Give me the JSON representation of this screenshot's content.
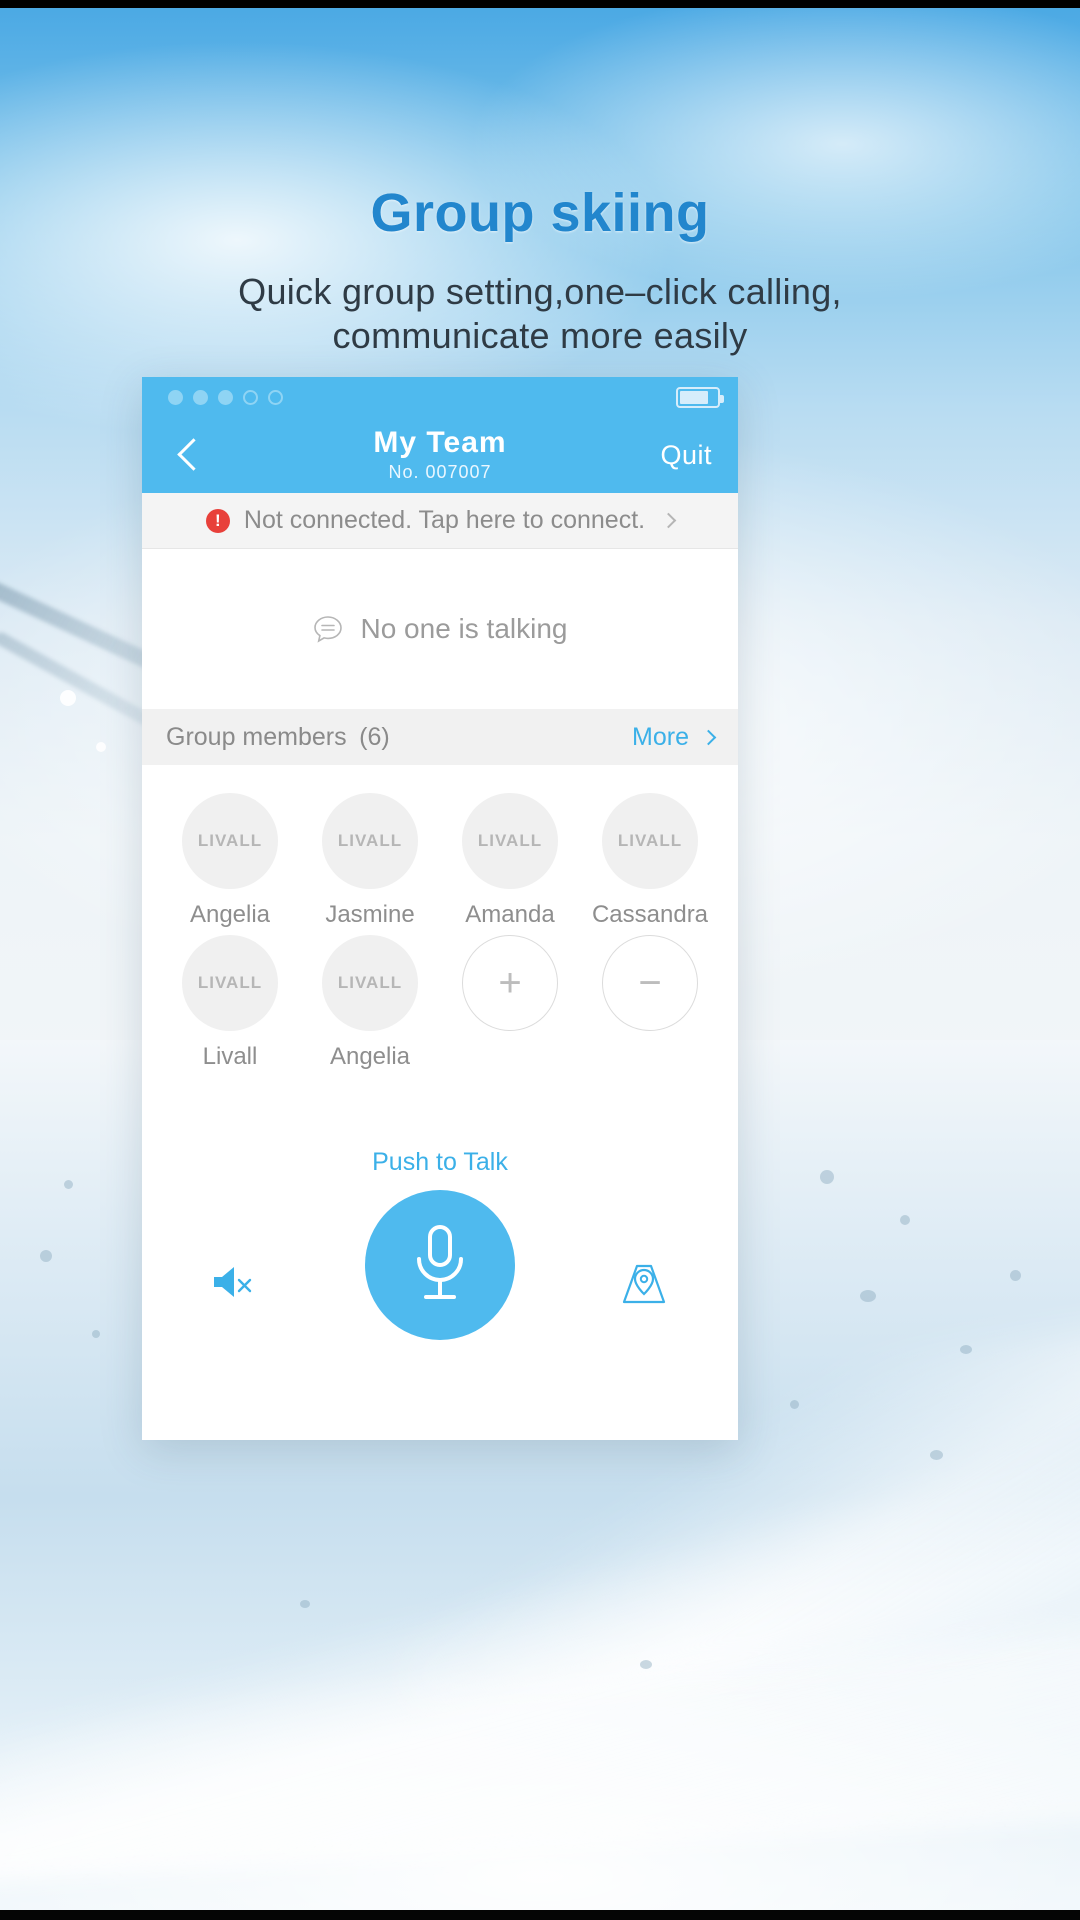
{
  "promo": {
    "headline": "Group skiing",
    "subhead_line1": "Quick group setting,one–click calling,",
    "subhead_line2": "communicate more easily",
    "headline_color": "#2286cd"
  },
  "phone": {
    "status_bar": {
      "signal_dots": [
        "filled",
        "filled",
        "filled",
        "hollow",
        "hollow"
      ],
      "battery_icon": "battery-icon",
      "battery_level_percent": 70,
      "accent_color": "#4fbaee"
    },
    "nav": {
      "back_icon": "chevron-left-icon",
      "title": "My Team",
      "subtitle": "No. 007007",
      "quit_label": "Quit"
    },
    "connect_banner": {
      "alert_icon": "alert-circle-icon",
      "alert_color": "#e8403a",
      "text": "Not connected. Tap here to connect.",
      "chevron_icon": "chevron-right-icon"
    },
    "talk_status": {
      "icon": "speech-bubble-icon",
      "text": "No one is talking"
    },
    "members_header": {
      "label": "Group members (6)",
      "more_label": "More",
      "more_chevron_icon": "chevron-right-icon",
      "more_color": "#3bb0e8"
    },
    "members": [
      {
        "avatar_logo": "LIVALL",
        "name": "Angelia"
      },
      {
        "avatar_logo": "LIVALL",
        "name": "Jasmine"
      },
      {
        "avatar_logo": "LIVALL",
        "name": "Amanda"
      },
      {
        "avatar_logo": "LIVALL",
        "name": "Cassandra"
      },
      {
        "avatar_logo": "LIVALL",
        "name": "Livall"
      },
      {
        "avatar_logo": "LIVALL",
        "name": "Angelia"
      }
    ],
    "member_actions": {
      "add_symbol": "+",
      "add_icon": "add-member-icon",
      "remove_symbol": "−",
      "remove_icon": "remove-member-icon"
    },
    "bottom_bar": {
      "ptt_label": "Push to Talk",
      "mic_icon": "microphone-icon",
      "mic_color": "#4fbaee",
      "mute_icon": "speaker-mute-icon",
      "location_icon": "location-pin-map-icon",
      "icon_color": "#3bb0e8"
    }
  }
}
